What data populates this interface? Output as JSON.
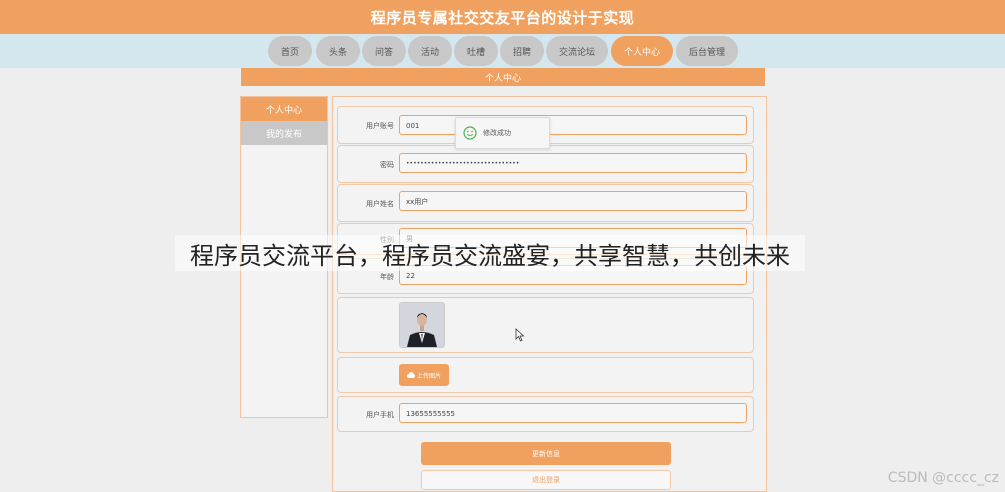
{
  "header": {
    "title": "程序员专属社交交友平台的设计于实现"
  },
  "nav": {
    "items": [
      {
        "label": "首页",
        "active": false
      },
      {
        "label": "头条",
        "active": false
      },
      {
        "label": "问答",
        "active": false
      },
      {
        "label": "活动",
        "active": false
      },
      {
        "label": "吐槽",
        "active": false
      },
      {
        "label": "招聘",
        "active": false
      },
      {
        "label": "交流论坛",
        "active": false
      },
      {
        "label": "个人中心",
        "active": true
      },
      {
        "label": "后台管理",
        "active": false
      }
    ]
  },
  "section": {
    "title": "个人中心"
  },
  "sidebar": {
    "items": [
      {
        "label": "个人中心",
        "active": true
      },
      {
        "label": "我的发布",
        "active": false
      }
    ]
  },
  "form": {
    "account_label": "用户账号",
    "account_value": "001",
    "password_label": "密码",
    "password_value": "••••••••••••••••••••••••••••••••",
    "name_label": "用户姓名",
    "name_value": "xx用户",
    "gender_label": "性别",
    "gender_value": "男",
    "age_label": "年龄",
    "age_value": "22",
    "upload_label": "上传图片",
    "phone_label": "用户手机",
    "phone_value": "13655555555",
    "update_button": "更新信息",
    "logout_button": "退出登录"
  },
  "toast": {
    "message": "修改成功"
  },
  "overlay_caption": "程序员交流平台，程序员交流盛宴，共享智慧，共创未来",
  "watermark": "CSDN @cccc_cz",
  "colors": {
    "accent": "#f0a160",
    "nav_band": "#d5e7ee",
    "inactive": "#c8c8c8",
    "success": "#4caf50"
  }
}
